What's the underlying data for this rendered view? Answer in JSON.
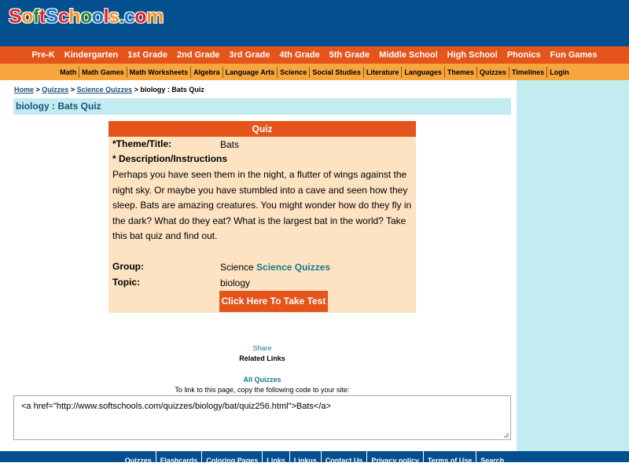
{
  "logo": {
    "letters": [
      "S",
      "o",
      "f",
      "t",
      "S",
      "c",
      "h",
      "o",
      "o",
      "l",
      "s",
      ".",
      "c",
      "o",
      "m"
    ],
    "colors": [
      "#e8202a",
      "#f7931e",
      "#2a8a2a",
      "#e8202a",
      "#1c75bc",
      "#e8202a",
      "#f7931e",
      "#2a8a2a",
      "#1c75bc",
      "#e8202a",
      "#f7931e",
      "#2a8a2a",
      "#1c75bc",
      "#e8202a",
      "#f7931e"
    ]
  },
  "nav_primary": [
    "Pre-K",
    "Kindergarten",
    "1st Grade",
    "2nd Grade",
    "3rd Grade",
    "4th Grade",
    "5th Grade",
    "Middle School",
    "High School",
    "Phonics",
    "Fun Games"
  ],
  "nav_secondary": [
    "Math",
    "Math Games",
    "Math Worksheets",
    "Algebra",
    "Language Arts",
    "Science",
    "Social Studies",
    "Literature",
    "Languages",
    "Themes",
    "Quizzes",
    "Timelines",
    "Login"
  ],
  "breadcrumb": {
    "home": "Home",
    "sep1": " > ",
    "quizzes": "Quizzes",
    "sep2": " > ",
    "science": "Science Quizzes",
    "current": " > biology : Bats Quiz"
  },
  "page_title": "biology : Bats Quiz",
  "quiz": {
    "header": "Quiz",
    "theme_label": "*Theme/Title:",
    "theme_value": "Bats",
    "desc_label": "* Description/Instructions",
    "description": "Perhaps you have seen them in the night, a flutter of wings against the night sky. Or maybe you have stumbled into a cave and seen how they sleep. Bats are amazing creatures. You might wonder how do they fly in the dark? What do they eat? What is the largest bat in the world? Take this bat quiz and find out.",
    "group_label": "Group:",
    "group_value": "Science",
    "group_link": "Science Quizzes",
    "topic_label": "Topic:",
    "topic_value": "biology",
    "take_test": "Click Here To Take Test"
  },
  "share": "Share",
  "related_links": "Related Links",
  "all_quizzes": "All Quizzes",
  "link_info": "To link to this page, copy the following code to your site:",
  "link_code": "<a href=\"http://www.softschools.com/quizzes/biology/bat/quiz256.html\">Bats</a>",
  "footer": [
    "Quizzes",
    "Flashcards",
    "Coloring Pages",
    "Links",
    "Linkus",
    "Contact Us",
    "Privacy policy",
    "Terms of Use",
    "Search"
  ],
  "colors": {
    "header_blue": "#04508f",
    "nav_orange": "#e4541b",
    "subnav_orange": "#f7a63d",
    "sidebar_blue": "#c3ecf0",
    "quiz_bg": "#fde3c1"
  }
}
